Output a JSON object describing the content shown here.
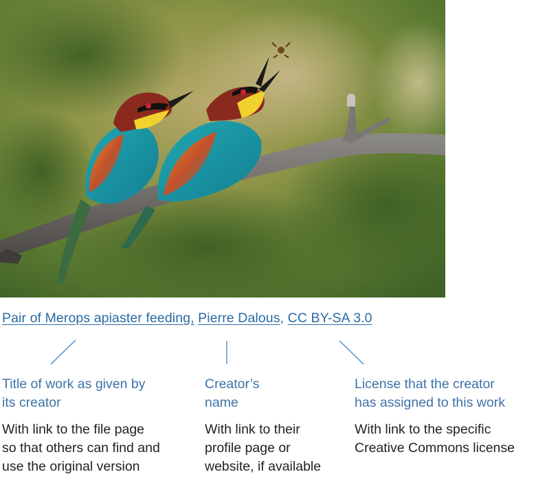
{
  "image": {
    "subject": "bee-eaters-photo"
  },
  "credit": {
    "title_link": "Pair of Merops apiaster feeding,",
    "creator_link": "Pierre Dalous",
    "separator": ",",
    "license_link": "CC BY-SA 3.0"
  },
  "annotations": [
    {
      "heading_line1": "Title of work as given by",
      "heading_line2": "its creator",
      "desc_line1": "With link to the file page",
      "desc_line2": "so that others can find and",
      "desc_line3": "use the original version"
    },
    {
      "heading_line1": "Creator’s",
      "heading_line2": "name",
      "desc_line1": "With link to their",
      "desc_line2": "profile page or",
      "desc_line3": "website, if available"
    },
    {
      "heading_line1": "License that the creator",
      "heading_line2": "has assigned to this work",
      "desc_line1": "With link to the specific",
      "desc_line2": "Creative Commons license",
      "desc_line3": ""
    }
  ],
  "colors": {
    "link": "#2a6aa4",
    "heading": "#3d72a8",
    "body_text": "#222222",
    "connector": "#3d86c6"
  }
}
